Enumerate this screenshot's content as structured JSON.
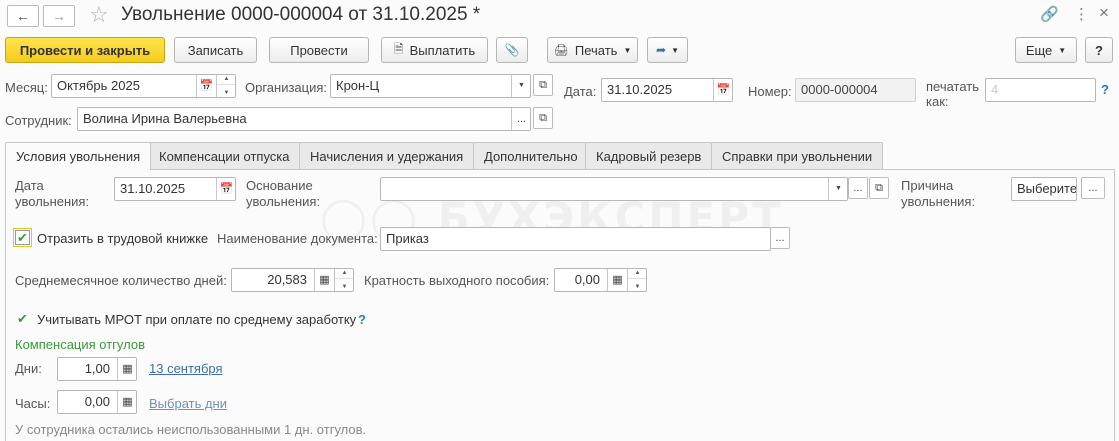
{
  "header": {
    "title": "Увольнение 0000-000004 от 31.10.2025 *",
    "back_icon": "arrow-left-icon",
    "forward_icon": "arrow-right-icon",
    "favorite_icon": "star-icon",
    "link_icon": "link-icon",
    "menu_icon": "more-vertical-icon",
    "close_icon": "close-icon"
  },
  "toolbar": {
    "post_close": "Провести и закрыть",
    "save": "Записать",
    "post": "Провести",
    "pay": "Выплатить",
    "print": "Печать",
    "more": "Еще",
    "help": "?"
  },
  "fields": {
    "month_label": "Месяц:",
    "month_value": "Октябрь 2025",
    "org_label": "Организация:",
    "org_value": "Крон-Ц",
    "date_label": "Дата:",
    "date_value": "31.10.2025",
    "number_label": "Номер:",
    "number_value": "0000-000004",
    "print_as_label_1": "печатать",
    "print_as_label_2": "как:",
    "print_as_placeholder": "4",
    "employee_label": "Сотрудник:",
    "employee_value": "Волина Ирина Валерьевна"
  },
  "tabs": [
    {
      "label": "Условия увольнения",
      "active": true
    },
    {
      "label": "Компенсации отпуска"
    },
    {
      "label": "Начисления и удержания"
    },
    {
      "label": "Дополнительно"
    },
    {
      "label": "Кадровый резерв"
    },
    {
      "label": "Справки при увольнении"
    }
  ],
  "conditions": {
    "dismiss_date_label_1": "Дата",
    "dismiss_date_label_2": "увольнения:",
    "dismiss_date_value": "31.10.2025",
    "basis_label_1": "Основание",
    "basis_label_2": "увольнения:",
    "basis_value": "",
    "reason_label_1": "Причина",
    "reason_label_2": "увольнения:",
    "reason_value": "Выберите",
    "workbook_label": "Отразить в трудовой книжке",
    "workbook_checked": true,
    "doc_name_label": "Наименование документа:",
    "doc_name_value": "Приказ",
    "avg_days_label": "Среднемесячное количество дней:",
    "avg_days_value": "20,583",
    "severance_label": "Кратность выходного пособия:",
    "severance_value": "0,00",
    "mrot_label": "Учитывать МРОТ при оплате по среднему заработку",
    "mrot_checked": true,
    "comp_heading": "Компенсация отгулов",
    "days_label": "Дни:",
    "days_value": "1,00",
    "days_link": "13 сентября",
    "hours_label": "Часы:",
    "hours_value": "0,00",
    "hours_link": "Выбрать дни",
    "footer_note": "У сотрудника остались неиспользованными 1 дн. отгулов."
  },
  "watermark_text": "БУХЭКСПЕРТ",
  "colors": {
    "primary_button": "#f5cc1d",
    "accent_green": "#3a9a3a",
    "link_blue": "#3b6ea8",
    "help_blue": "#2a77c5"
  }
}
